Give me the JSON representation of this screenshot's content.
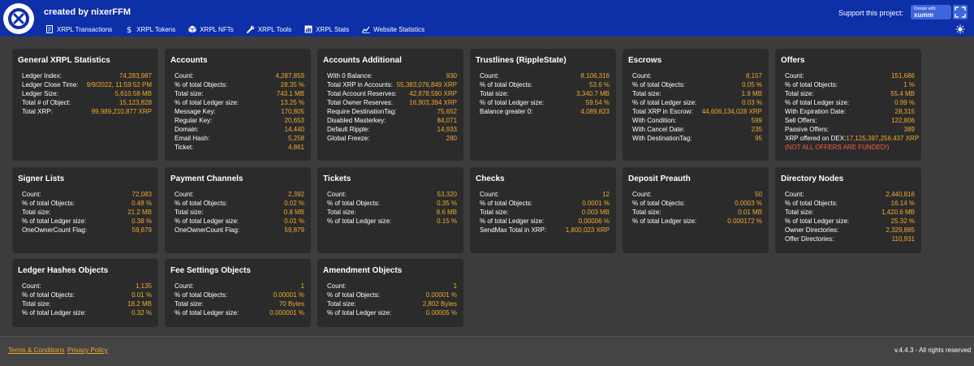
{
  "header": {
    "brand": "created by nixerFFM",
    "support_label": "Support this project:",
    "donate_small": "Donate with:",
    "donate_brand": "xumm",
    "nav": [
      {
        "label": "XRPL Transactions",
        "icon": "receipt-icon"
      },
      {
        "label": "XRPL Tokens",
        "icon": "dollar-icon"
      },
      {
        "label": "XRPL NFTs",
        "icon": "cube-icon"
      },
      {
        "label": "XRPL Tools",
        "icon": "wrench-icon"
      },
      {
        "label": "XRPL Stats",
        "icon": "bar-chart-icon"
      },
      {
        "label": "Website Statistics",
        "icon": "line-chart-icon"
      }
    ]
  },
  "cards": {
    "general": {
      "title": "General XRPL Statistics",
      "rows": [
        {
          "k": "Ledger Index:",
          "v": "74,283,987"
        },
        {
          "k": "Ledger Close Time:",
          "v": "9/9/2022, 11:59:52 PM"
        },
        {
          "k": "Ledger Size:",
          "v": "5,610.58 MB"
        },
        {
          "k": "Total # of Object:",
          "v": "15,123,828"
        },
        {
          "k": "Total XRP:",
          "v": "99,989,210,877 XRP"
        }
      ]
    },
    "accounts": {
      "title": "Accounts",
      "rows": [
        {
          "k": "Count:",
          "v": "4,287,859"
        },
        {
          "k": "% of total Objects:",
          "v": "28.35 %"
        },
        {
          "k": "Total size:",
          "v": "743.1 MB"
        },
        {
          "k": "% of total Ledger size:",
          "v": "13.25 %"
        },
        {
          "k": "Message Key:",
          "v": "170,805"
        },
        {
          "k": "Regular Key:",
          "v": "20,653"
        },
        {
          "k": "Domain:",
          "v": "14,440"
        },
        {
          "k": "Email Hash:",
          "v": "5,258"
        },
        {
          "k": "Ticket:",
          "v": "4,861"
        }
      ]
    },
    "accounts_additional": {
      "title": "Accounts Additional",
      "rows": [
        {
          "k": "With 0 Balance:",
          "v": "930"
        },
        {
          "k": "Total XRP in Accounts:",
          "v": "55,383,076,849 XRP"
        },
        {
          "k": "Total Account Reserves:",
          "v": "42,878,590 XRP"
        },
        {
          "k": "Total Owner Reserves:",
          "v": "16,903,394 XRP"
        },
        {
          "k": "Require DestinationTag:",
          "v": "75,652"
        },
        {
          "k": "Disabled Masterkey:",
          "v": "84,071"
        },
        {
          "k": "Default Ripple:",
          "v": "14,933"
        },
        {
          "k": "Global Freeze:",
          "v": "280"
        }
      ]
    },
    "trustlines": {
      "title": "Trustlines (RippleState)",
      "rows": [
        {
          "k": "Count:",
          "v": "8,106,316"
        },
        {
          "k": "% of total Objects:",
          "v": "53.6 %"
        },
        {
          "k": "Total size:",
          "v": "3,340.7 MB"
        },
        {
          "k": "% of total Ledger size:",
          "v": "59.54 %"
        },
        {
          "k": "Balance greater 0:",
          "v": "4,089,823"
        }
      ]
    },
    "escrows": {
      "title": "Escrows",
      "rows": [
        {
          "k": "Count:",
          "v": "8,157"
        },
        {
          "k": "% of total Objects:",
          "v": "0.05 %"
        },
        {
          "k": "Total size:",
          "v": "1.9 MB"
        },
        {
          "k": "% of total Ledger size:",
          "v": "0.03 %"
        },
        {
          "k": "Total XRP in Escrow:",
          "v": "44,606,134,028 XRP"
        },
        {
          "k": "With Condition:",
          "v": "599"
        },
        {
          "k": "With Cancel Date:",
          "v": "235"
        },
        {
          "k": "With DestinationTag:",
          "v": "95"
        }
      ]
    },
    "offers": {
      "title": "Offers",
      "rows": [
        {
          "k": "Count:",
          "v": "151,686"
        },
        {
          "k": "% of total Objects:",
          "v": "1 %"
        },
        {
          "k": "Total size:",
          "v": "55.4 MB"
        },
        {
          "k": "% of total Ledger size:",
          "v": "0.99 %"
        },
        {
          "k": "With Expiration Date:",
          "v": "28,315"
        },
        {
          "k": "Sell Offers:",
          "v": "122,806"
        },
        {
          "k": "Passive Offers:",
          "v": "389"
        },
        {
          "k": "XRP offered on DEX:",
          "v": "17,125,397,256,437 XRP"
        }
      ],
      "note": "(NOT ALL OFFERS ARE FUNDED!)"
    },
    "signer_lists": {
      "title": "Signer Lists",
      "rows": [
        {
          "k": "Count:",
          "v": "72,083"
        },
        {
          "k": "% of total Objects:",
          "v": "0.48 %"
        },
        {
          "k": "Total size:",
          "v": "21.2 MB"
        },
        {
          "k": "% of total Ledger size:",
          "v": "0.38 %"
        },
        {
          "k": "OneOwnerCount Flag:",
          "v": "59,879"
        }
      ]
    },
    "payment_channels": {
      "title": "Payment Channels",
      "rows": [
        {
          "k": "Count:",
          "v": "2,392"
        },
        {
          "k": "% of total Objects:",
          "v": "0.02 %"
        },
        {
          "k": "Total size:",
          "v": "0.8 MB"
        },
        {
          "k": "% of total Ledger size:",
          "v": "0.01 %"
        },
        {
          "k": "OneOwnerCount Flag:",
          "v": "59,879"
        }
      ]
    },
    "tickets": {
      "title": "Tickets",
      "rows": [
        {
          "k": "Count:",
          "v": "53,320"
        },
        {
          "k": "% of total Objects:",
          "v": "0.35 %"
        },
        {
          "k": "Total size:",
          "v": "8.6 MB"
        },
        {
          "k": "% of total Ledger size:",
          "v": "0.15 %"
        }
      ]
    },
    "checks": {
      "title": "Checks",
      "rows": [
        {
          "k": "Count:",
          "v": "12"
        },
        {
          "k": "% of total Objects:",
          "v": "0.0001 %"
        },
        {
          "k": "Total size:",
          "v": "0.003 MB"
        },
        {
          "k": "% of total Ledger size:",
          "v": "0.00006 %"
        },
        {
          "k": "SendMax Total in XRP:",
          "v": "1,800,023 XRP"
        }
      ]
    },
    "deposit_preauth": {
      "title": "Deposit Preauth",
      "rows": [
        {
          "k": "Count:",
          "v": "50"
        },
        {
          "k": "% of total Objects:",
          "v": "0.0003 %"
        },
        {
          "k": "Total size:",
          "v": "0.01 MB"
        },
        {
          "k": "% of total Ledger size:",
          "v": "0.000172 %"
        }
      ]
    },
    "directory_nodes": {
      "title": "Directory Nodes",
      "rows": [
        {
          "k": "Count:",
          "v": "2,440,816"
        },
        {
          "k": "% of total Objects:",
          "v": "16.14 %"
        },
        {
          "k": "Total size:",
          "v": "1,420.6 MB"
        },
        {
          "k": "% of total Ledger size:",
          "v": "25.32 %"
        },
        {
          "k": "Owner Directories:",
          "v": "2,329,885"
        },
        {
          "k": "Offer Directories:",
          "v": "110,931"
        }
      ]
    },
    "ledger_hashes": {
      "title": "Ledger Hashes Objects",
      "rows": [
        {
          "k": "Count:",
          "v": "1,135"
        },
        {
          "k": "% of total Objects:",
          "v": "0.01 %"
        },
        {
          "k": "Total size:",
          "v": "18.2 MB"
        },
        {
          "k": "% of total Ledger size:",
          "v": "0.32 %"
        }
      ]
    },
    "fee_settings": {
      "title": "Fee Settings Objects",
      "rows": [
        {
          "k": "Count:",
          "v": "1"
        },
        {
          "k": "% of total Objects:",
          "v": "0.00001 %"
        },
        {
          "k": "Total size:",
          "v": "70 Bytes"
        },
        {
          "k": "% of total Ledger size:",
          "v": "0.000001 %"
        }
      ]
    },
    "amendment": {
      "title": "Amendment Objects",
      "rows": [
        {
          "k": "Count:",
          "v": "1"
        },
        {
          "k": "% of total Objects:",
          "v": "0.00001 %"
        },
        {
          "k": "Total size:",
          "v": "2,802 Bytes"
        },
        {
          "k": "% of total Ledger size:",
          "v": "0.00005 %"
        }
      ]
    }
  },
  "footer": {
    "terms": "Terms & Conditions",
    "privacy": "Privacy Policy",
    "version": "v.4.4.3 - All rights reserved"
  },
  "colors": {
    "header": "#0d2fa8",
    "value": "#f0a92f",
    "warning": "#ff5a4d",
    "card": "#2b2b2b",
    "page": "#3c3c3c"
  }
}
